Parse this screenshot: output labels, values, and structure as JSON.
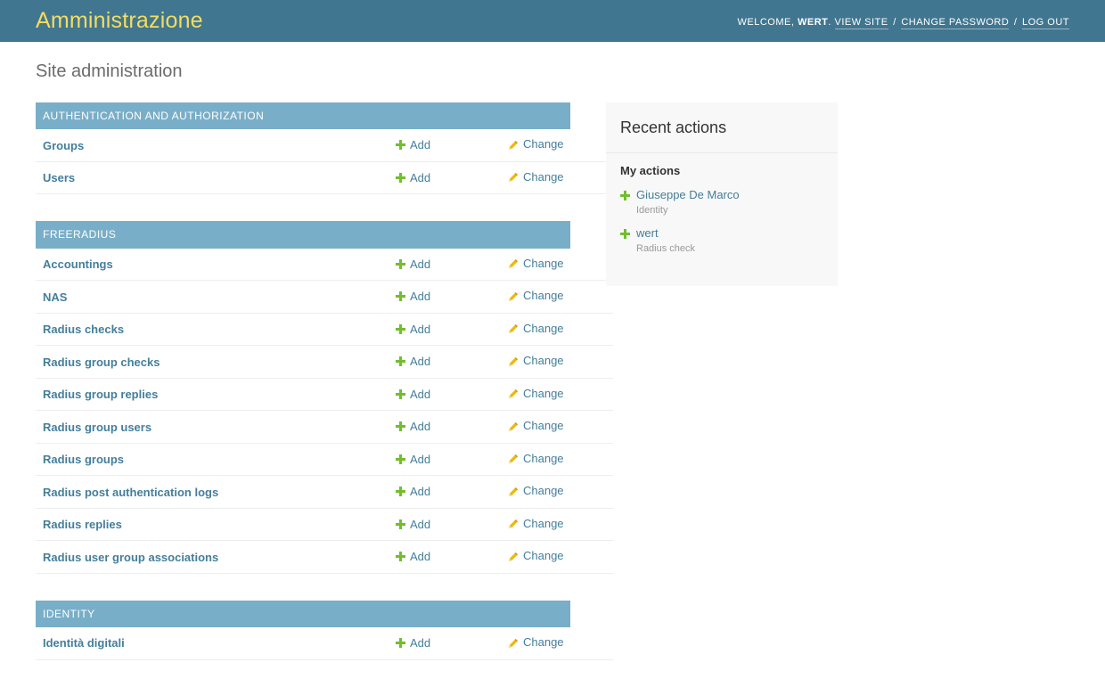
{
  "header": {
    "site_title": "Amministrazione",
    "welcome_prefix": "Welcome,",
    "username": "wert",
    "welcome_suffix": ".",
    "links": [
      {
        "label": "View site"
      },
      {
        "label": "Change password"
      },
      {
        "label": "Log out"
      }
    ],
    "separator": "/",
    "colors": {
      "header_bg": "#417690",
      "brand_text": "#f5dd5d",
      "caption_bg": "#79aec8",
      "link_blue": "#447e9b",
      "add_green": "#70bf2b",
      "change_yellow": "#efb80b"
    }
  },
  "page": {
    "title": "Site administration"
  },
  "icons": {
    "add": "plus-icon",
    "change": "pencil-icon"
  },
  "modules": [
    {
      "caption": "Authentication and Authorization",
      "models": [
        {
          "name": "Groups",
          "add_label": "Add",
          "change_label": "Change"
        },
        {
          "name": "Users",
          "add_label": "Add",
          "change_label": "Change"
        }
      ]
    },
    {
      "caption": "FreeRADIUS",
      "models": [
        {
          "name": "Accountings",
          "add_label": "Add",
          "change_label": "Change"
        },
        {
          "name": "NAS",
          "add_label": "Add",
          "change_label": "Change"
        },
        {
          "name": "Radius checks",
          "add_label": "Add",
          "change_label": "Change"
        },
        {
          "name": "Radius group checks",
          "add_label": "Add",
          "change_label": "Change"
        },
        {
          "name": "Radius group replies",
          "add_label": "Add",
          "change_label": "Change"
        },
        {
          "name": "Radius group users",
          "add_label": "Add",
          "change_label": "Change"
        },
        {
          "name": "Radius groups",
          "add_label": "Add",
          "change_label": "Change"
        },
        {
          "name": "Radius post authentication logs",
          "add_label": "Add",
          "change_label": "Change"
        },
        {
          "name": "Radius replies",
          "add_label": "Add",
          "change_label": "Change"
        },
        {
          "name": "Radius user group associations",
          "add_label": "Add",
          "change_label": "Change"
        }
      ]
    },
    {
      "caption": "Identity",
      "models": [
        {
          "name": "Identità digitali",
          "add_label": "Add",
          "change_label": "Change"
        }
      ]
    }
  ],
  "sidebar": {
    "title": "Recent actions",
    "subtitle": "My actions",
    "actions": [
      {
        "label": "Giuseppe De Marco",
        "type": "Identity"
      },
      {
        "label": "wert",
        "type": "Radius check"
      }
    ]
  }
}
